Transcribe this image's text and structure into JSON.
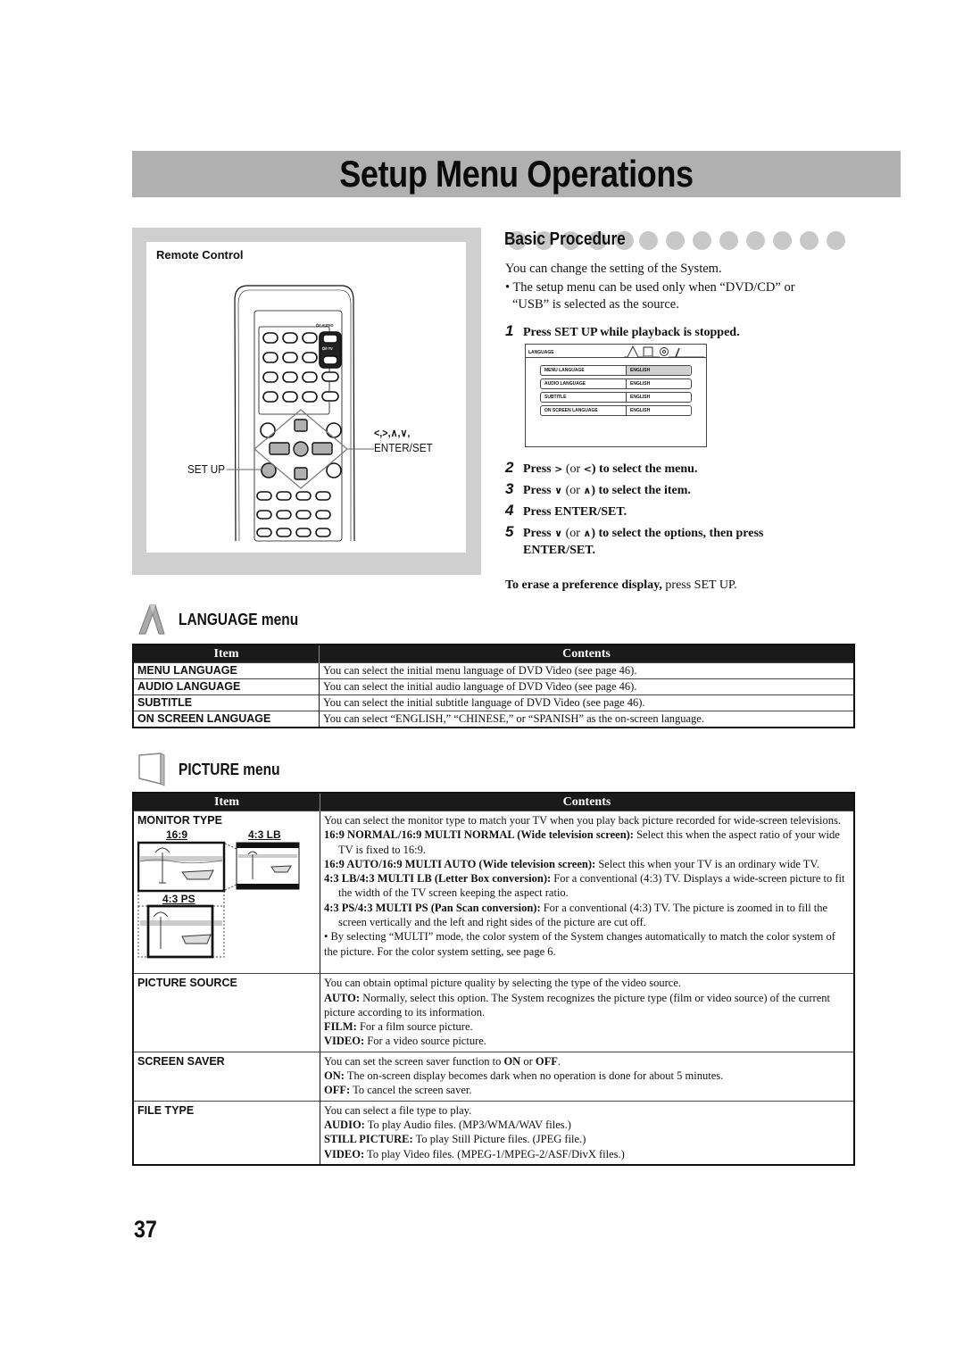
{
  "page_title": "Setup Menu Operations",
  "remote": {
    "label": "Remote Control",
    "callout_setup": "SET UP",
    "callout_arrows": "<,>,∧,∨,",
    "callout_enter": "ENTER/SET",
    "audio_label": "⏻/I AUDIO",
    "tv_label": "⏻/I TV"
  },
  "basic_procedure": {
    "heading": "Basic Procedure",
    "intro": "You can change the setting of the System.",
    "note": "• The setup menu can be used only when “DVD/CD” or",
    "note2": "“USB” is selected as the source.",
    "steps": [
      {
        "num": "1",
        "text": "Press SET UP while playback is stopped."
      },
      {
        "num": "2",
        "pre": "Press",
        "k1": ">",
        "mid": "(or",
        "k2": "<",
        "post": ") to select the menu."
      },
      {
        "num": "3",
        "pre": "Press",
        "k1": "∨",
        "mid": "(or",
        "k2": "∧",
        "post": ") to select the item."
      },
      {
        "num": "4",
        "text": "Press ENTER/SET."
      },
      {
        "num": "5",
        "pre": "Press",
        "k1": "∨",
        "mid": "(or",
        "k2": "∧",
        "post": ") to select the options, then press",
        "line2": "ENTER/SET."
      }
    ],
    "erase_bold": "To erase a preference display,",
    "erase_rest": " press SET UP."
  },
  "osd": {
    "tab": "LANGUAGE",
    "rows": [
      {
        "key": "MENU LANGUAGE",
        "value": "ENGLISH",
        "selected": true
      },
      {
        "key": "AUDIO LANGUAGE",
        "value": "ENGLISH",
        "selected": false
      },
      {
        "key": "SUBTITLE",
        "value": "ENGLISH",
        "selected": false
      },
      {
        "key": "ON SCREEN LANGUAGE",
        "value": "ENGLISH",
        "selected": false
      }
    ]
  },
  "language_menu": {
    "heading": "LANGUAGE menu",
    "col_item": "Item",
    "col_contents": "Contents",
    "rows": [
      {
        "item": "MENU LANGUAGE",
        "contents": "You can select the initial menu language of DVD Video (see page 46)."
      },
      {
        "item": "AUDIO LANGUAGE",
        "contents": "You can select the initial audio language of DVD Video (see page 46)."
      },
      {
        "item": "SUBTITLE",
        "contents": "You can select the initial subtitle language of DVD Video (see page 46)."
      },
      {
        "item": "ON SCREEN LANGUAGE",
        "contents": "You can select “ENGLISH,” “CHINESE,” or “SPANISH” as the on-screen language."
      }
    ]
  },
  "picture_menu": {
    "heading": "PICTURE menu",
    "col_item": "Item",
    "col_contents": "Contents",
    "monitor_type": {
      "item": "MONITOR TYPE",
      "labels": {
        "wide": "16:9",
        "lb": "4:3 LB",
        "ps": "4:3 PS"
      },
      "intro": "You can select the monitor type to match your TV when you play back picture recorded for wide-screen televisions.",
      "options": [
        {
          "bold": "16:9 NORMAL/16:9 MULTI NORMAL (Wide television screen):",
          "text": " Select this when the aspect ratio of your wide TV is fixed to 16:9."
        },
        {
          "bold": "16:9 AUTO/16:9 MULTI AUTO (Wide television screen):",
          "text": " Select this when your TV is an ordinary wide TV."
        },
        {
          "bold": "4:3 LB/4:3 MULTI LB (Letter Box conversion):",
          "text": " For a conventional (4:3) TV. Displays a wide-screen picture to fit the width of the TV screen keeping the aspect ratio."
        },
        {
          "bold": "4:3 PS/4:3 MULTI PS (Pan Scan conversion):",
          "text": " For a conventional (4:3) TV. The picture is zoomed in to fill the screen vertically and the left and right sides of the picture are cut off."
        }
      ],
      "bullet": "• By selecting “MULTI” mode, the color system of the System changes automatically to match the color system of the picture. For the color system setting, see page 6."
    },
    "picture_source": {
      "item": "PICTURE SOURCE",
      "intro": "You can obtain optimal picture quality by selecting the type of the video source.",
      "options": [
        {
          "bold": "AUTO:",
          "text": " Normally, select this option. The System recognizes the picture type (film or video source) of the current picture according to its information."
        },
        {
          "bold": "FILM:",
          "text": " For a film source picture."
        },
        {
          "bold": "VIDEO:",
          "text": " For a video source picture."
        }
      ]
    },
    "screen_saver": {
      "item": "SCREEN SAVER",
      "intro_a": "You can set the screen saver function to ",
      "intro_on": "ON",
      "intro_or": " or ",
      "intro_off": "OFF",
      "intro_end": ".",
      "options": [
        {
          "bold": "ON:",
          "text": " The on-screen display becomes dark when no operation is done for about 5 minutes."
        },
        {
          "bold": "OFF:",
          "text": " To cancel the screen saver."
        }
      ]
    },
    "file_type": {
      "item": "FILE TYPE",
      "intro": "You can select a file type to play.",
      "options": [
        {
          "bold": "AUDIO:",
          "text": " To play Audio files. (MP3/WMA/WAV files.)"
        },
        {
          "bold": "STILL PICTURE:",
          "text": " To play Still Picture files. (JPEG file.)"
        },
        {
          "bold": "VIDEO:",
          "text": " To play Video files. (MPEG-1/MPEG-2/ASF/DivX files.)"
        }
      ]
    }
  },
  "page_number": "37"
}
